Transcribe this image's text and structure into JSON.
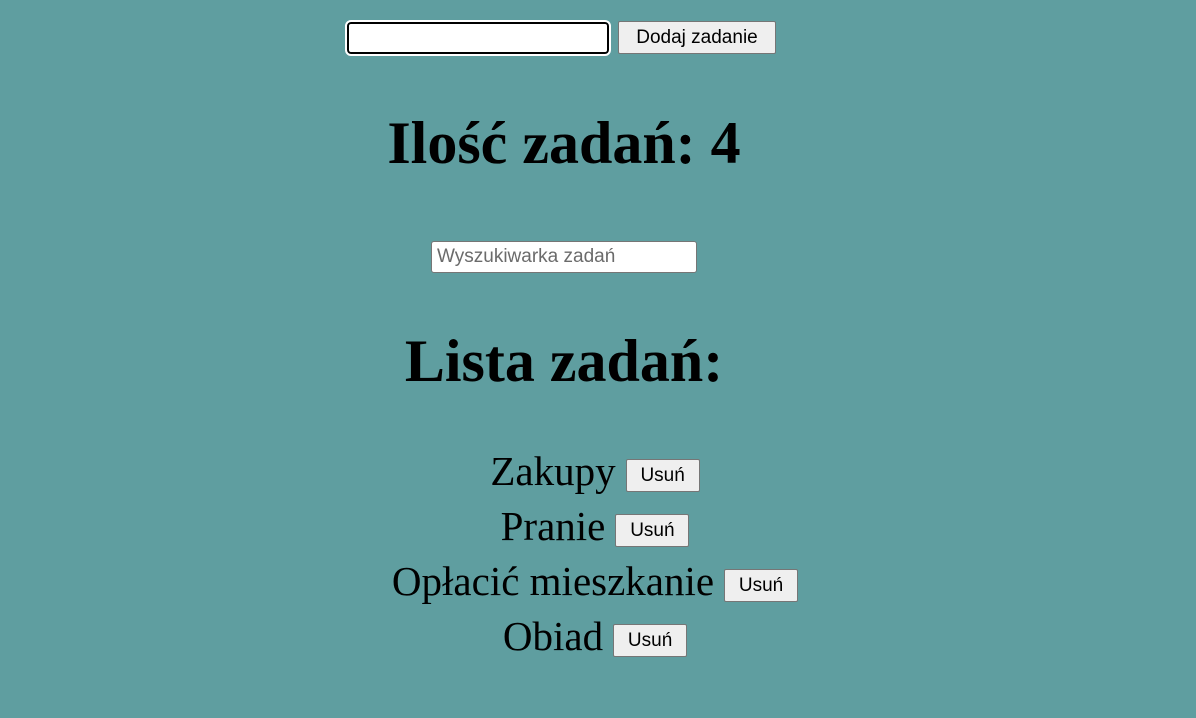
{
  "add_form": {
    "input_value": "",
    "button_label": "Dodaj zadanie"
  },
  "counter": {
    "text": "Ilość zadań: 4"
  },
  "search": {
    "placeholder": "Wyszukiwarka zadań",
    "value": ""
  },
  "list": {
    "heading": "Lista zadań:",
    "items": [
      {
        "name": "Zakupy",
        "remove_label": "Usuń"
      },
      {
        "name": "Pranie",
        "remove_label": "Usuń"
      },
      {
        "name": "Opłacić mieszkanie",
        "remove_label": "Usuń"
      },
      {
        "name": "Obiad",
        "remove_label": "Usuń"
      }
    ]
  },
  "colors": {
    "background": "#5f9ea0"
  }
}
